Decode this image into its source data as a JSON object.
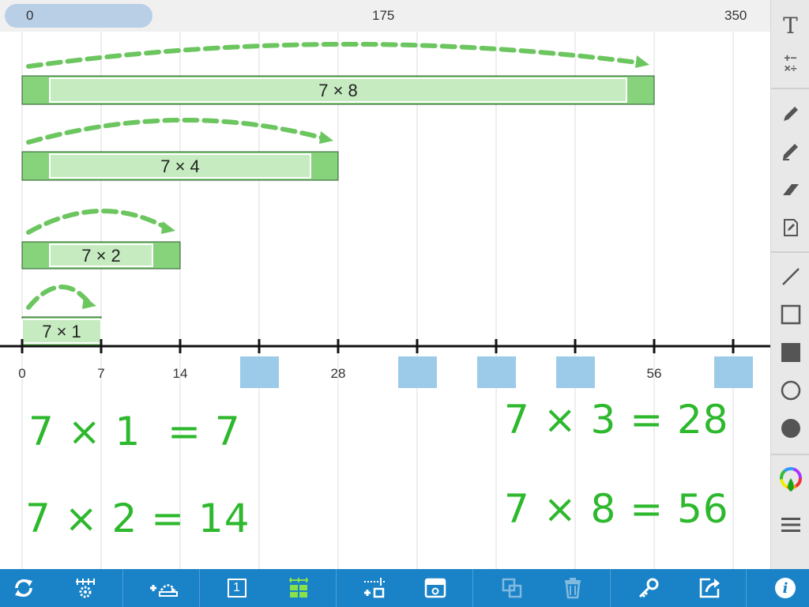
{
  "scroll_strip": {
    "labels": [
      "0",
      "175",
      "350"
    ]
  },
  "number_line": {
    "min": 0,
    "max": 63,
    "tick_step": 7,
    "visible_labels": [
      {
        "value": 0,
        "text": "0"
      },
      {
        "value": 7,
        "text": "7"
      },
      {
        "value": 14,
        "text": "14"
      },
      {
        "value": 28,
        "text": "28"
      },
      {
        "value": 56,
        "text": "56"
      }
    ],
    "hidden_label_values": [
      21,
      35,
      42,
      49,
      63
    ]
  },
  "bars": [
    {
      "factor": 8,
      "value": 56,
      "label": "7 × 8"
    },
    {
      "factor": 4,
      "value": 28,
      "label": "7 × 4"
    },
    {
      "factor": 2,
      "value": 14,
      "label": "7 × 2"
    },
    {
      "factor": 1,
      "value": 7,
      "label": "7 × 1"
    }
  ],
  "equations": [
    {
      "text": "7 × 1  = 7"
    },
    {
      "text": "7 × 2 = 14"
    },
    {
      "text": "7 × 3 = 28"
    },
    {
      "text": "7 × 8 = 56"
    }
  ],
  "colors": {
    "bar_fill": "#86d37c",
    "bar_inner": "#c6ebc1",
    "arc": "#6cc65f",
    "hide_box": "#9ccbea",
    "equation": "#2db82d",
    "toolbar_blue": "#1a82c6"
  },
  "right_toolbar": {
    "tools": [
      "text-tool",
      "math-tool",
      "pen-tool",
      "marker-tool",
      "eraser-tool",
      "note-tool",
      "line-tool",
      "rectangle-outline-tool",
      "rectangle-filled-tool",
      "circle-outline-tool",
      "circle-filled-tool",
      "color-picker",
      "menu"
    ],
    "text_glyph": "T",
    "math_glyph_top": "+−",
    "math_glyph_bottom": "×÷"
  },
  "bottom_toolbar": {
    "tools": [
      "reset",
      "settings",
      "add-jump",
      "show-unit",
      "show-grid",
      "add-marker",
      "hide-box",
      "duplicate",
      "delete",
      "key",
      "share",
      "info"
    ],
    "unit_glyph": "1",
    "info_glyph": "i"
  }
}
